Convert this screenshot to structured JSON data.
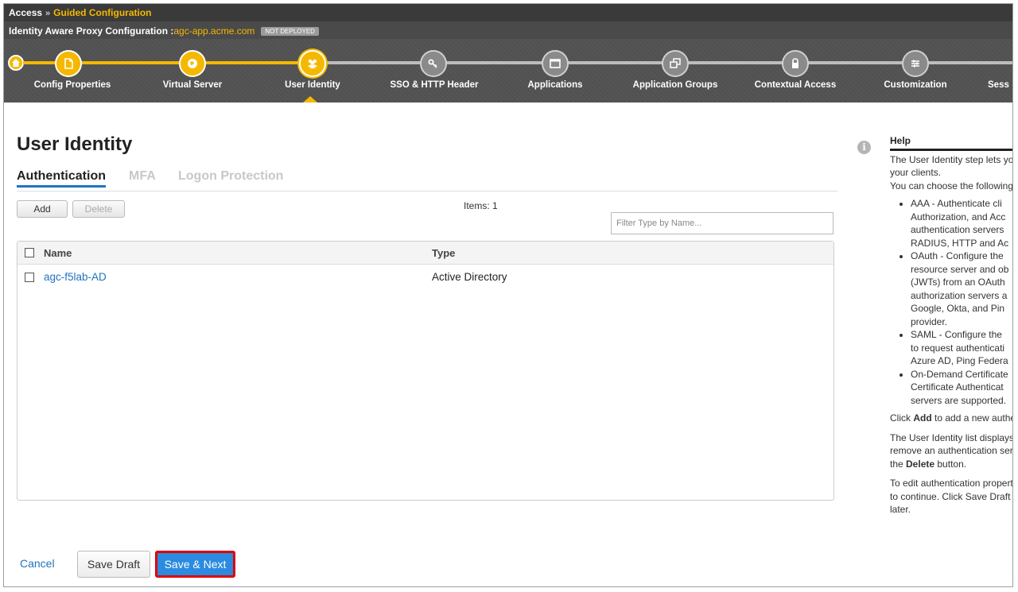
{
  "breadcrumb": {
    "root": "Access",
    "separator": "»",
    "current": "Guided Configuration"
  },
  "config_bar": {
    "label": "Identity Aware Proxy Configuration :",
    "app_name": "agc-app.acme.com",
    "status_badge": "NOT DEPLOYED"
  },
  "wizard": {
    "steps": [
      {
        "label": "Config Properties",
        "state": "done",
        "icon": "document-icon"
      },
      {
        "label": "Virtual Server",
        "state": "done",
        "icon": "globe-icon"
      },
      {
        "label": "User Identity",
        "state": "current",
        "icon": "users-icon"
      },
      {
        "label": "SSO & HTTP Header",
        "state": "future",
        "icon": "key-icon"
      },
      {
        "label": "Applications",
        "state": "future",
        "icon": "window-icon"
      },
      {
        "label": "Application Groups",
        "state": "future",
        "icon": "windows-stack-icon"
      },
      {
        "label": "Contextual Access",
        "state": "future",
        "icon": "lock-icon"
      },
      {
        "label": "Customization",
        "state": "future",
        "icon": "sliders-icon"
      },
      {
        "label": "Sess",
        "state": "future",
        "icon": ""
      }
    ]
  },
  "main": {
    "title": "User Identity",
    "tabs": [
      {
        "label": "Authentication",
        "active": true
      },
      {
        "label": "MFA",
        "active": false
      },
      {
        "label": "Logon Protection",
        "active": false
      }
    ],
    "add_label": "Add",
    "delete_label": "Delete",
    "items_count": "Items: 1",
    "filter_placeholder": "Filter Type by Name...",
    "table": {
      "columns": [
        "Name",
        "Type"
      ],
      "rows": [
        {
          "name": "agc-f5lab-AD",
          "type": "Active Directory"
        }
      ]
    }
  },
  "footer": {
    "cancel_label": "Cancel",
    "save_draft_label": "Save Draft",
    "save_next_label": "Save & Next"
  },
  "help": {
    "title": "Help",
    "intro_lines": [
      "The User Identity step lets yo",
      "your clients.",
      "You can choose the following"
    ],
    "bullets": [
      [
        "AAA - Authenticate cli",
        "Authorization, and Acc",
        "authentication servers",
        "RADIUS, HTTP and Ac"
      ],
      [
        "OAuth - Configure the",
        "resource server and ob",
        "(JWTs) from an OAuth",
        "authorization servers a",
        "Google, Okta, and Pin",
        "provider."
      ],
      [
        "SAML - Configure the",
        "to request authenticati",
        "Azure AD, Ping Federa"
      ],
      [
        "On-Demand Certificate",
        "Certificate Authenticat",
        "servers are supported."
      ]
    ],
    "add_para": {
      "pre": "Click ",
      "bold": "Add",
      "post": " to add a new authe"
    },
    "list_para": {
      "line1": "The User Identity list displays",
      "line2": "remove an authentication serv",
      "pre": "the ",
      "bold": "Delete",
      "post": " button."
    },
    "edit_para": [
      "To edit authentication properti",
      "to continue. Click Save Draft",
      "later."
    ]
  },
  "colors": {
    "accent": "#f5b800",
    "link": "#1e73be",
    "primary_button": "#2a8be0",
    "highlight_border": "#e00000"
  }
}
